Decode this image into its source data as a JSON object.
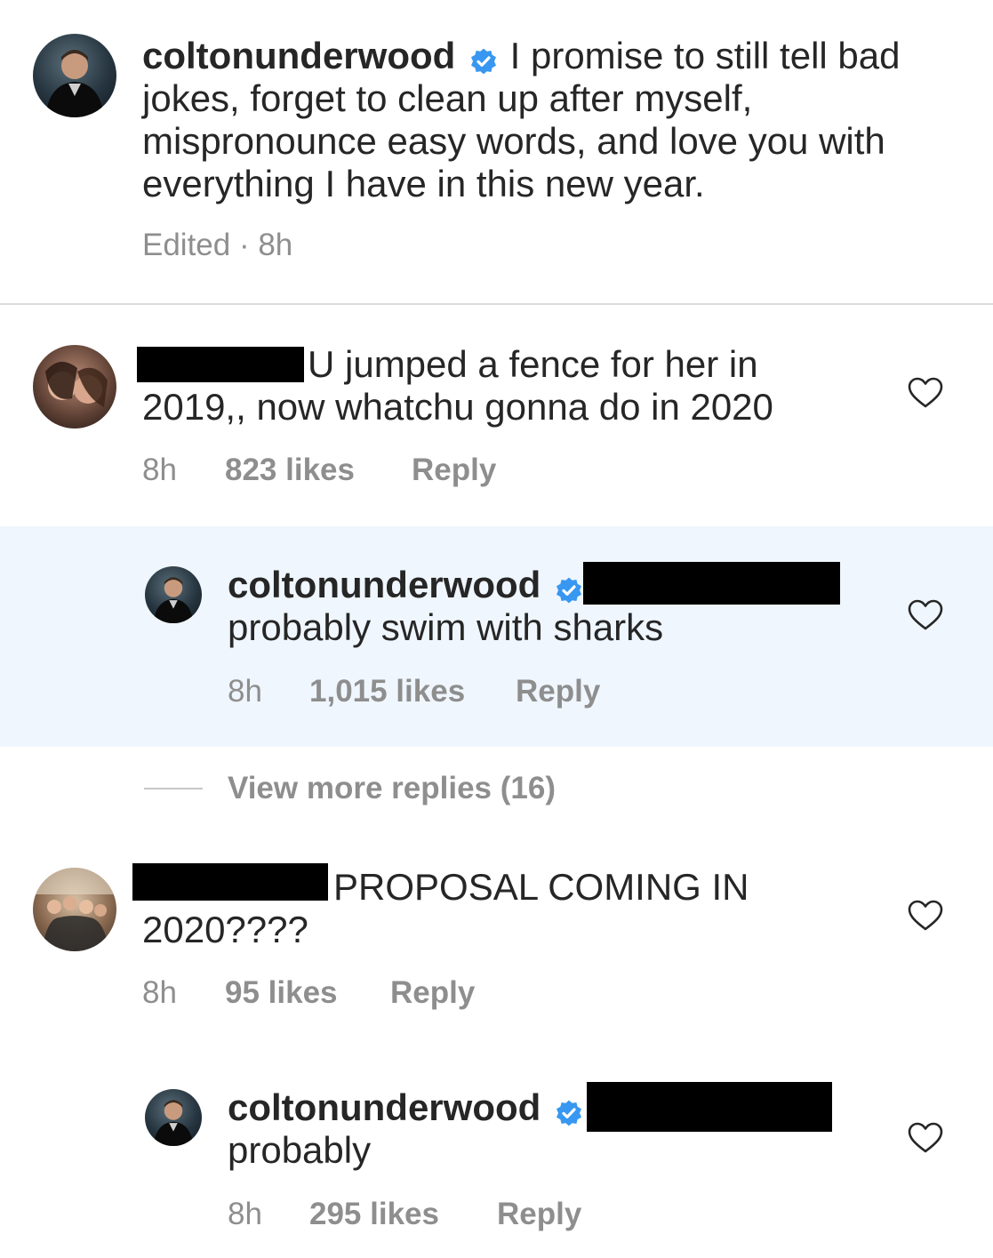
{
  "caption": {
    "username": "coltonunderwood",
    "text": "I promise to still tell bad jokes, forget to clean up after myself, mispronounce easy words, and love you with everything I have in this new year.",
    "line1": "I promise to still tell bad",
    "line2": "jokes, forget to clean up after myself,",
    "line3": "mispronounce easy words, and love you with",
    "line4": "everything I have in this new year.",
    "meta": "Edited · 8h"
  },
  "comments": [
    {
      "text_line1": "U jumped a fence for her in",
      "text_line2": "2019,, now whatchu gonna do in 2020",
      "time": "8h",
      "likes": "823 likes",
      "reply": "Reply"
    },
    {
      "username": "coltonunderwood",
      "text": "probably swim with sharks",
      "time": "8h",
      "likes": "1,015 likes",
      "reply": "Reply"
    },
    {
      "view_more": "View more replies (16)"
    },
    {
      "text_line1": "PROPOSAL COMING IN",
      "text_line2": "2020????",
      "time": "8h",
      "likes": "95 likes",
      "reply": "Reply"
    },
    {
      "username": "coltonunderwood",
      "text": "probably",
      "time": "8h",
      "likes": "295 likes",
      "reply": "Reply"
    }
  ],
  "icons": {
    "verified": "verified-badge-icon",
    "like": "heart-outline-icon"
  },
  "colors": {
    "verified_blue": "#3897f0",
    "meta_gray": "#8e8e8e",
    "highlight_bg": "#eff6fd"
  }
}
